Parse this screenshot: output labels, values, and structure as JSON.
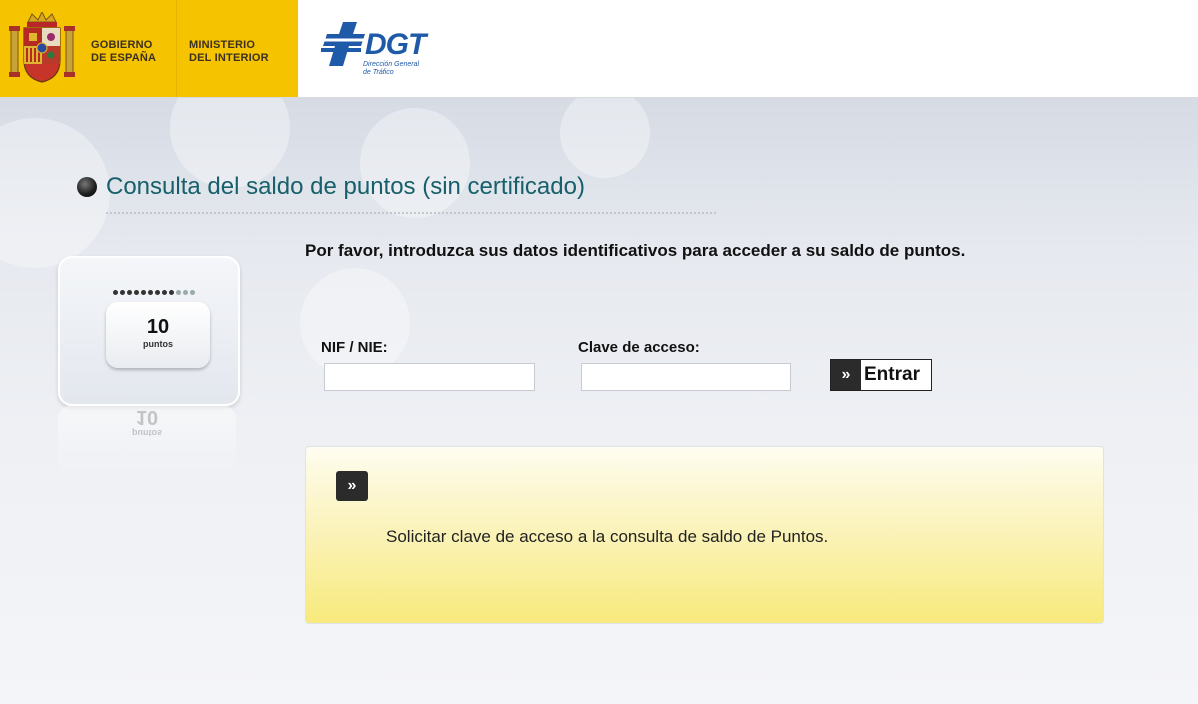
{
  "header": {
    "government": {
      "line1": "GOBIERNO",
      "line2": "DE ESPAÑA"
    },
    "ministry": {
      "line1": "MINISTERIO",
      "line2": "DEL INTERIOR"
    },
    "dgt": {
      "name": "DGT",
      "subtitle_line1": "Dirección General",
      "subtitle_line2": "de Tráfico"
    },
    "colors": {
      "government_band": "#f5c300",
      "dgt_blue": "#1e5aa8"
    }
  },
  "page": {
    "title": "Consulta del saldo de puntos (sin certificado)",
    "intro": "Por favor, introduzca sus datos identificativos para acceder a su saldo de puntos.",
    "title_color": "#17606b"
  },
  "points_card": {
    "points": "10",
    "unit": "puntos",
    "reflection_points": "10",
    "reflection_unit": "puntos"
  },
  "form": {
    "nif_label": "NIF / NIE:",
    "nif_value": "",
    "clave_label": "Clave de acceso:",
    "clave_value": "",
    "submit_icon": "»",
    "submit_label": "Entrar"
  },
  "request_panel": {
    "icon": "»",
    "link_text": "Solicitar clave de acceso a la consulta de saldo de Puntos.",
    "panel_color": "#f8ea7d"
  }
}
